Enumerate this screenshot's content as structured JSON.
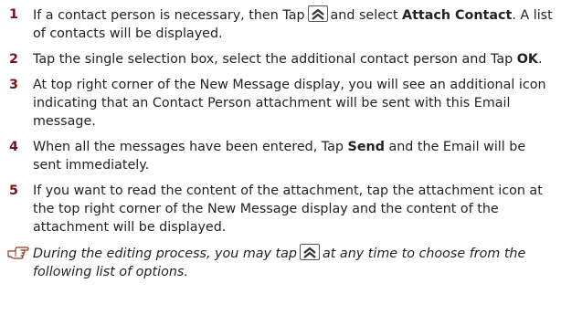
{
  "steps": [
    {
      "num": "1",
      "a": "If a contact person is necessary, then Tap",
      "icon": "double-chevron-up-icon",
      "b": "and select",
      "bold1": "Attach Contact",
      "c": ". A list of contacts will be displayed."
    },
    {
      "num": "2",
      "a": "Tap the single selection box, select the additional contact person and Tap",
      "bold1": "OK",
      "c": "."
    },
    {
      "num": "3",
      "text": "At top right corner of the New Message display, you will see an additional icon indicating that an Contact Person attachment will be sent with this Email message."
    },
    {
      "num": "4",
      "a": "When all the messages have been entered, Tap",
      "bold1": "Send",
      "c": "and the Email will be sent immediately."
    },
    {
      "num": "5",
      "text": "If you want to read the content of the attachment, tap the attachment icon at the top right corner of the New Message display and the content of the attachment will be displayed."
    }
  ],
  "note": {
    "icon": "pointing-hand-icon",
    "a": "During the editing process, you may tap",
    "icon2": "double-chevron-up-icon",
    "b": "at any time to choose from the following list of options."
  },
  "colors": {
    "step_number": "#7a1318",
    "text": "#222222"
  }
}
